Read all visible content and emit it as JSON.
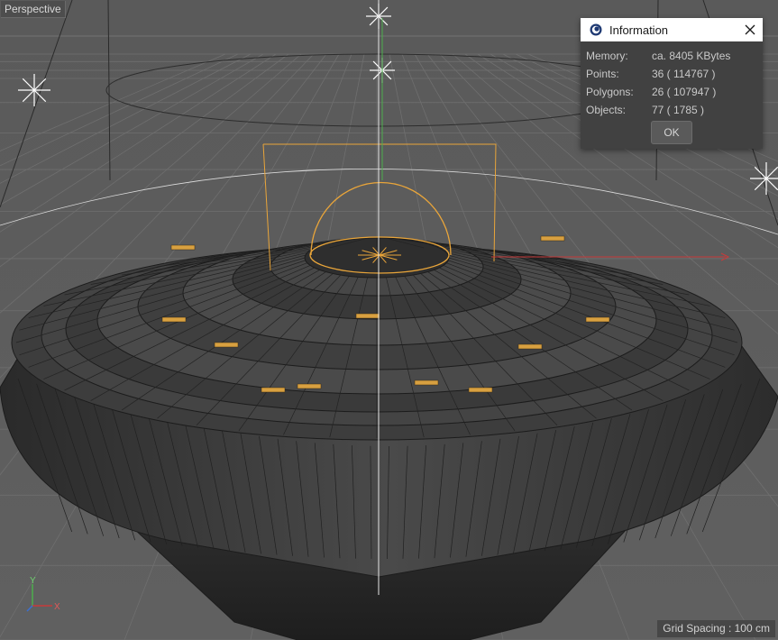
{
  "viewport": {
    "camera_label": "Perspective",
    "grid_spacing": "Grid Spacing : 100 cm",
    "axes": {
      "y": "Y",
      "x": "X"
    }
  },
  "info_dialog": {
    "title": "Information",
    "icon": "cinema4d-icon",
    "close_icon": "close-icon",
    "rows": [
      {
        "key": "Memory:",
        "value": "ca. 8405 KBytes"
      },
      {
        "key": "Points:",
        "value": "36 ( 114767 )"
      },
      {
        "key": "Polygons:",
        "value": "26 ( 107947 )"
      },
      {
        "key": "Objects:",
        "value": "77 ( 1785 )"
      }
    ],
    "ok_label": "OK"
  },
  "colors": {
    "background": "#5d5d5d",
    "grid": "#6f6f6f",
    "wire": "#1c1c1c",
    "hull": "#3a3a3a",
    "selection": "#e9a53a",
    "x_axis": "#c83a3a",
    "y_axis": "#4cae4c"
  }
}
